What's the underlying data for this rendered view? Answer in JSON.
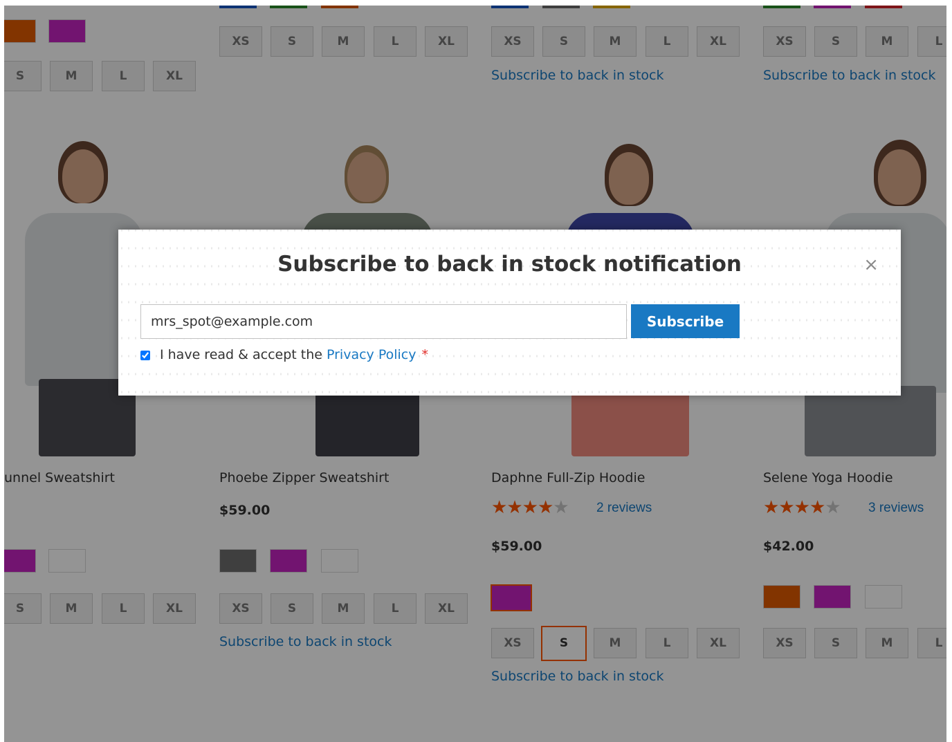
{
  "link_label": "Subscribe to back in stock",
  "size_labels": [
    "XS",
    "S",
    "M",
    "L",
    "XL"
  ],
  "products": [
    {
      "name": "unnel Sweatshirt",
      "price": "",
      "rating": 0,
      "reviews": ""
    },
    {
      "name": "Phoebe Zipper Sweatshirt",
      "price": "$59.00",
      "rating": 0,
      "reviews": ""
    },
    {
      "name": "Daphne Full-Zip Hoodie",
      "price": "$59.00",
      "rating": 4,
      "reviews": "2 reviews",
      "selected_size": "S"
    },
    {
      "name": "Selene Yoga Hoodie",
      "price": "$42.00",
      "rating": 4,
      "reviews": "3 reviews"
    }
  ],
  "colors": {
    "orange": "#e05a00",
    "purple": "#c424c1",
    "gray": "#6d6d6d",
    "white": "#ffffff",
    "blue": "#1959c9",
    "green": "#2d8f2d",
    "yellow": "#e9b000",
    "red": "#d9262b",
    "accent": "#1979c3",
    "star": "#ff5501"
  },
  "modal": {
    "title": "Subscribe to back in stock notification",
    "close_glyph": "×",
    "email_value": "mrs_spot@example.com",
    "subscribe_label": "Subscribe",
    "consent_prefix": "I have read & accept the ",
    "consent_link": "Privacy Policy",
    "required_mark": "*",
    "consent_checked": true
  }
}
